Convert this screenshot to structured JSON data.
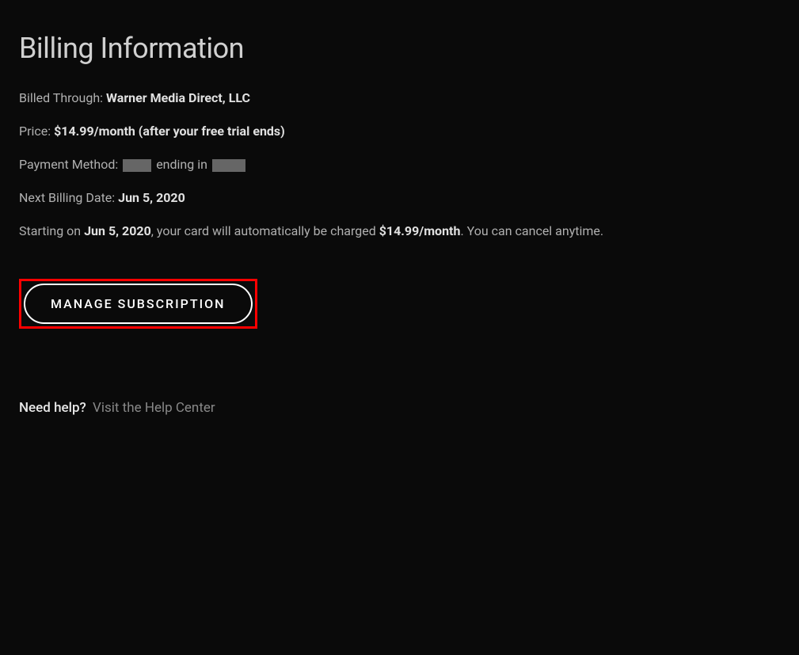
{
  "page": {
    "title": "Billing Information"
  },
  "billing": {
    "billed_through_label": "Billed Through: ",
    "billed_through_value": "Warner Media Direct, LLC",
    "price_label": "Price: ",
    "price_value": "$14.99/month (after your free trial ends)",
    "payment_method_label": "Payment Method: ",
    "payment_method_mid": "ending in",
    "next_billing_label": "Next Billing Date: ",
    "next_billing_value": "Jun 5, 2020",
    "auto_charge_prefix": "Starting on ",
    "auto_charge_date": "Jun 5, 2020",
    "auto_charge_mid": ", your card will automatically be charged ",
    "auto_charge_amount": "$14.99/month",
    "auto_charge_suffix": ". You can cancel anytime."
  },
  "buttons": {
    "manage_subscription": "MANAGE SUBSCRIPTION"
  },
  "help": {
    "label": "Need help?",
    "link_text": "Visit the Help Center"
  }
}
